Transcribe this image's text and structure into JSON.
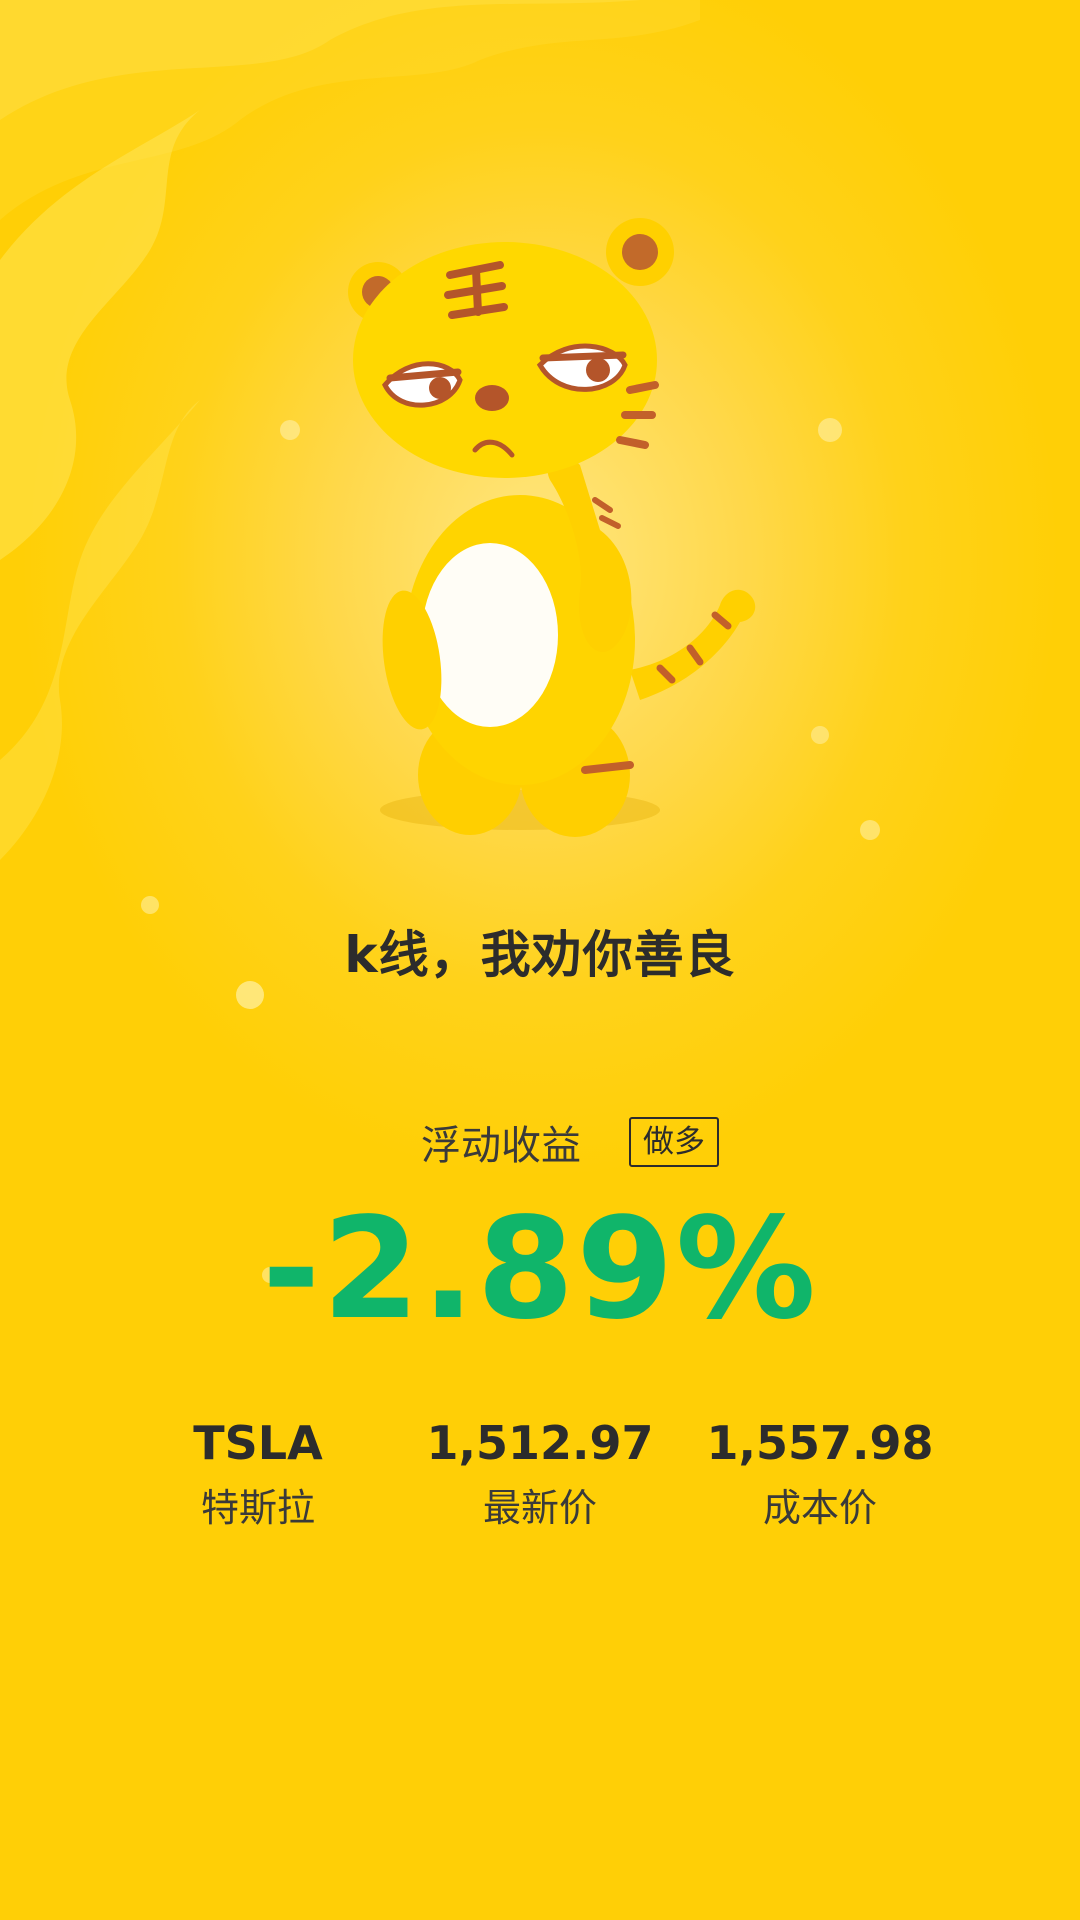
{
  "headline": "k线，我劝你善良",
  "pnl": {
    "label": "浮动收益",
    "badge": "做多",
    "value": "-2.89%",
    "value_color": "#10b56a"
  },
  "stats": [
    {
      "value": "TSLA",
      "label": "特斯拉"
    },
    {
      "value": "1,512.97",
      "label": "最新价"
    },
    {
      "value": "1,557.98",
      "label": "成本价"
    }
  ],
  "colors": {
    "background": "#ffd21a",
    "text": "#2c2c2c"
  },
  "illustration": "tiger-mascot"
}
